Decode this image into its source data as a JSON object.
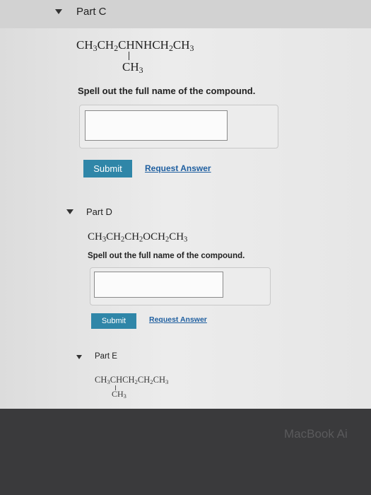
{
  "part_c": {
    "title": "Part C",
    "formula_main": [
      "CH",
      "3",
      "CH",
      "2",
      "CHNHCH",
      "2",
      "CH",
      "3"
    ],
    "formula_branch": [
      "CH",
      "3"
    ],
    "prompt": "Spell out the full name of the compound.",
    "answer_value": "",
    "submit_label": "Submit",
    "request_answer_label": "Request Answer"
  },
  "part_d": {
    "title": "Part D",
    "formula_main": [
      "CH",
      "3",
      "CH",
      "2",
      "CH",
      "2",
      "OCH",
      "2",
      "CH",
      "3"
    ],
    "prompt": "Spell out the full name of the compound.",
    "answer_value": "",
    "submit_label": "Submit",
    "request_answer_label": "Request Answer"
  },
  "part_e": {
    "title": "Part E",
    "formula_main": [
      "CH",
      "3",
      "CHCH",
      "2",
      "CH",
      "2",
      "CH",
      "3"
    ],
    "formula_branch": [
      "CH",
      "3"
    ]
  },
  "device": {
    "bezel_label": "MacBook Ai"
  },
  "colors": {
    "submit_button": "#2f86a8",
    "link": "#1f5fa0"
  }
}
